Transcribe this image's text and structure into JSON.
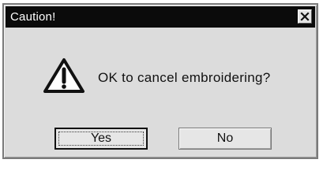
{
  "window": {
    "title": "Caution!",
    "close_icon": "close-icon"
  },
  "content": {
    "icon": "warning-icon",
    "message": "OK to cancel embroidering?"
  },
  "buttons": {
    "yes_label": "Yes",
    "no_label": "No"
  },
  "colors": {
    "titlebar": "#0b0b0b",
    "title_text": "#ffffff",
    "dialog_bg": "#dcdcdc",
    "button_bg": "#e6e6e6"
  }
}
